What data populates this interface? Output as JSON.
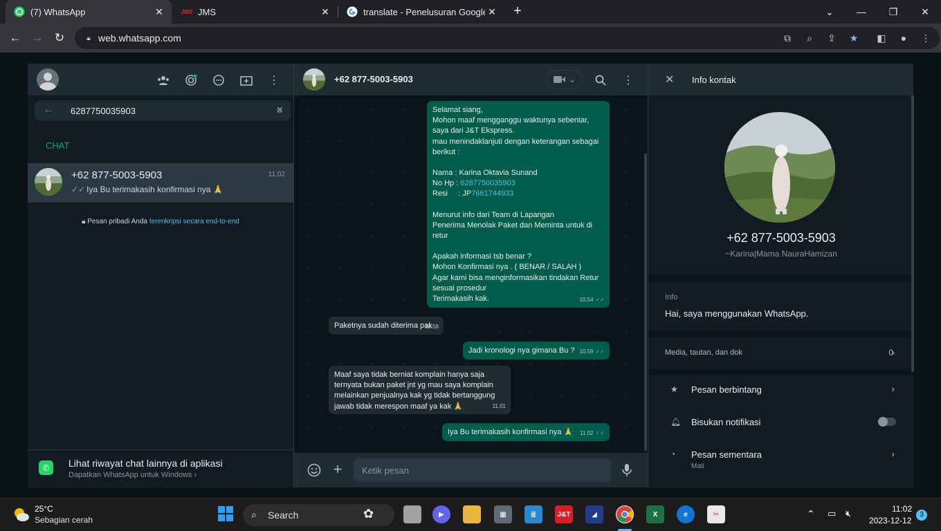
{
  "browser": {
    "tabs": [
      {
        "title": "(7) WhatsApp",
        "close": "✕"
      },
      {
        "title": "JMS",
        "close": "✕"
      },
      {
        "title": "translate - Penelusuran Google",
        "close": "✕"
      }
    ],
    "new_tab": "+",
    "url": "web.whatsapp.com"
  },
  "sidebar": {
    "search_value": "6287750035903",
    "section_label": "CHAT",
    "chat": {
      "name": "+62 877-5003-5903",
      "time": "11.02",
      "preview": "Iya Bu terimakasih konfirmasi nya 🙏"
    },
    "encryption_text": "Pesan pribadi Anda ",
    "encryption_link": "terenkripsi secara end-to-end",
    "footer_title": "Lihat riwayat chat lainnya di aplikasi",
    "footer_sub": "Dapatkan WhatsApp untuk Windows"
  },
  "chat": {
    "contact_name": "+62 877-5003-5903",
    "messages": [
      {
        "dir": "out",
        "lines": [
          "Selamat siang,",
          "Mohon maaf mengganggu waktunya sebentar,",
          "saya dari J&T Ekspress.",
          "mau menindaklanjuti dengan keterangan sebagai",
          "berikut :",
          "",
          "Nama  : Karina Oktavia Sunand",
          "No Hp : ",
          "Resi     : JP",
          "",
          "Menurut info dari Team di Lapangan",
          "Penerima Menolak Paket dan Meminta untuk di",
          "retur",
          "",
          "Apakah informasi tsb benar ?",
          "Mohon Konfirmasi nya . ( BENAR / SALAH )",
          "Agar kami bisa menginformasikan tindakan Retur",
          "sesuai prosedur",
          "Terimakasih kak."
        ],
        "phone_link": "6287750035903",
        "resi_link": "7661744933",
        "time": "10.54"
      },
      {
        "dir": "in",
        "text": "Paketnya sudah diterima pak",
        "time": "10.58"
      },
      {
        "dir": "out",
        "text": "Jadi kronologi nya gimana Bu ?",
        "time": "10.59"
      },
      {
        "dir": "in",
        "lines": [
          "Maaf saya tidak berniat komplain hanya saja",
          "ternyata bukan paket jnt yg mau saya komplain",
          "melainkan penjualnya kak yg tidak bertanggung",
          "jawab tidak merespon maaf ya kak 🙏"
        ],
        "time": "11.01"
      },
      {
        "dir": "out",
        "text": "Iya Bu terimakasih konfirmasi nya 🙏",
        "time": "11.02"
      }
    ],
    "composer_placeholder": "Ketik pesan"
  },
  "contact_info": {
    "header_title": "Info kontak",
    "number": "+62 877-5003-5903",
    "push_name": "~Karina|Mama NauraHamizan",
    "info_label": "Info",
    "info_value": "Hai, saya menggunakan WhatsApp.",
    "media_label": "Media, tautan, dan dok",
    "media_count": "0",
    "starred": "Pesan berbintang",
    "mute": "Bisukan notifikasi",
    "disappearing": "Pesan sementara",
    "disappearing_value": "Mati"
  },
  "taskbar": {
    "temp": "25°C",
    "weather": "Sebagian cerah",
    "search_label": "Search",
    "time": "11:02",
    "date": "2023-12-12",
    "notification_count": "3"
  },
  "colors": {
    "wa_green": "#00a884",
    "out_bubble": "#005c4b",
    "in_bubble": "#202c33",
    "panel": "#111b21",
    "link": "#53bdeb"
  }
}
